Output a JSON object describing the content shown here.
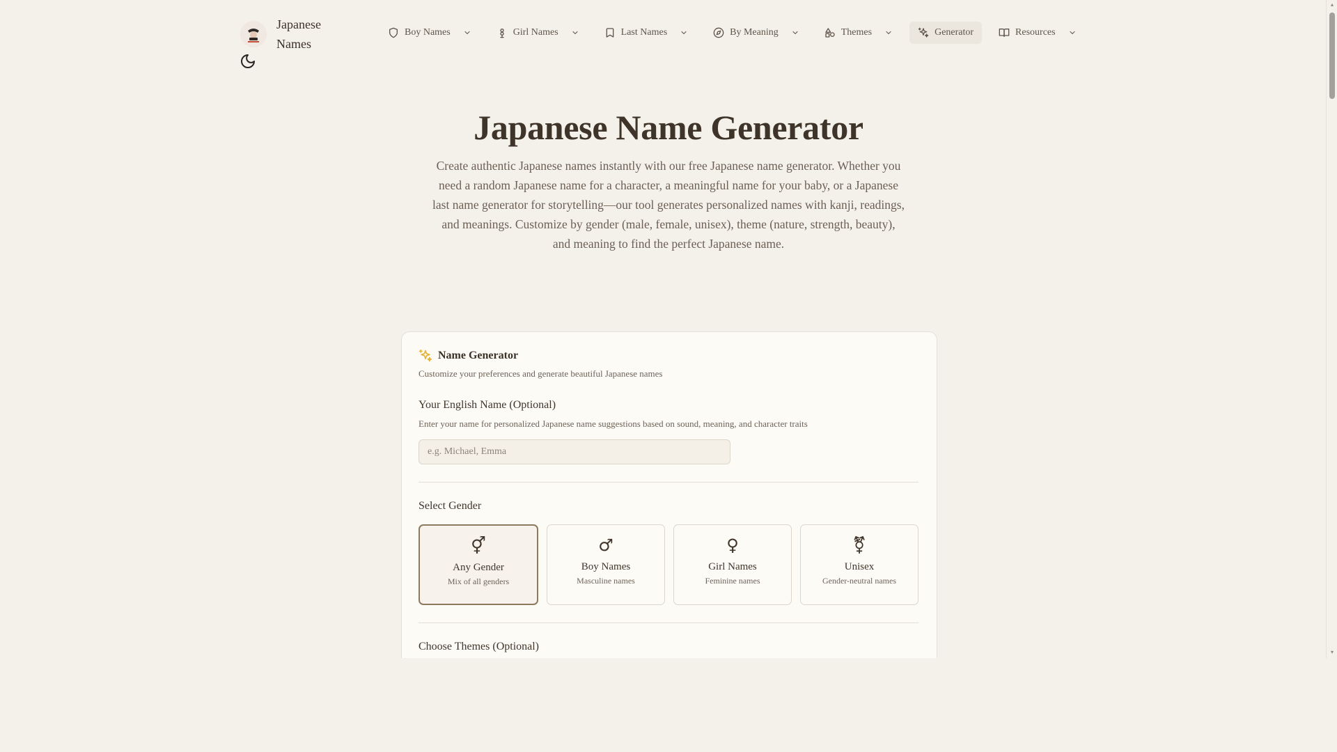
{
  "site": {
    "name": "Japanese Names"
  },
  "nav": [
    {
      "label": "Boy Names",
      "icon": "shield-icon"
    },
    {
      "label": "Girl Names",
      "icon": "flower-icon"
    },
    {
      "label": "Last Names",
      "icon": "bookmark-icon"
    },
    {
      "label": "By Meaning",
      "icon": "compass-icon"
    },
    {
      "label": "Themes",
      "icon": "shapes-icon"
    },
    {
      "label": "Generator",
      "icon": "sparkles-icon",
      "active": true
    },
    {
      "label": "Resources",
      "icon": "book-open-icon"
    }
  ],
  "hero": {
    "title": "Japanese Name Generator",
    "description": "Create authentic Japanese names instantly with our free Japanese name generator. Whether you need a random Japanese name for a character, a meaningful name for your baby, or a Japanese last name generator for storytelling—our tool generates personalized names with kanji, readings, and meanings. Customize by gender (male, female, unisex), theme (nature, strength, beauty), and meaning to find the perfect Japanese name."
  },
  "generator": {
    "title": "Name Generator",
    "subtitle": "Customize your preferences and generate beautiful Japanese names",
    "english_name": {
      "label": "Your English Name (Optional)",
      "help": "Enter your name for personalized Japanese name suggestions based on sound, meaning, and character traits",
      "placeholder": "e.g. Michael, Emma",
      "value": ""
    },
    "gender": {
      "label": "Select Gender",
      "selected": "Any Gender",
      "options": [
        {
          "symbol": "⚥",
          "label": "Any Gender",
          "sub": "Mix of all genders"
        },
        {
          "symbol": "♂",
          "label": "Boy Names",
          "sub": "Masculine names"
        },
        {
          "symbol": "♀",
          "label": "Girl Names",
          "sub": "Feminine names"
        },
        {
          "symbol": "⚧",
          "label": "Unisex",
          "sub": "Gender-neutral names"
        }
      ]
    },
    "themes": {
      "label": "Choose Themes (Optional)"
    }
  },
  "colors": {
    "background": "#f4f1ea",
    "card": "#fdfbf6",
    "text": "#3e3429",
    "accent_sparkle": "#e3b43a",
    "selected_border": "#8d7a5e"
  },
  "icons": {
    "theme_toggle": "moon-icon",
    "logo": "logo-emblem"
  }
}
